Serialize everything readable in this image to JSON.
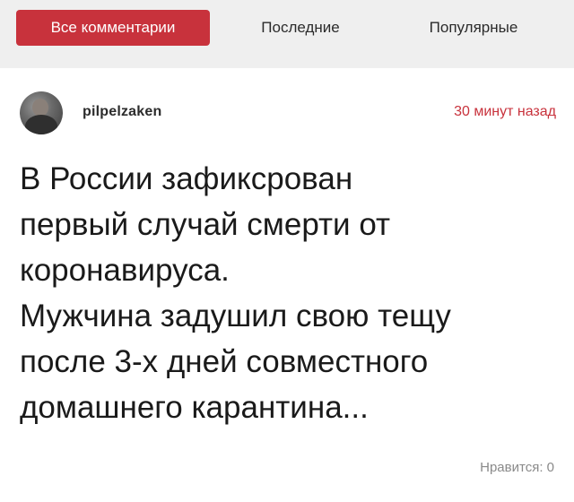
{
  "tabs": [
    {
      "label": "Все комментарии",
      "active": true
    },
    {
      "label": "Последние",
      "active": false
    },
    {
      "label": "Популярные",
      "active": false
    }
  ],
  "comment": {
    "username": "pilpelzaken",
    "timestamp": "30 минут назад",
    "text_lines": [
      "В России зафиксрован",
      "первый случай смерти от",
      "коронавируса.",
      "Мужчина задушил свою тещу",
      "после 3-х дней совместного",
      "домашнего карантина..."
    ],
    "likes": "Нравится: 0"
  },
  "colors": {
    "accent": "#c8323c",
    "tab_bar_bg": "#efefef",
    "text": "#1a1a1a",
    "muted": "#8a8a8a"
  }
}
